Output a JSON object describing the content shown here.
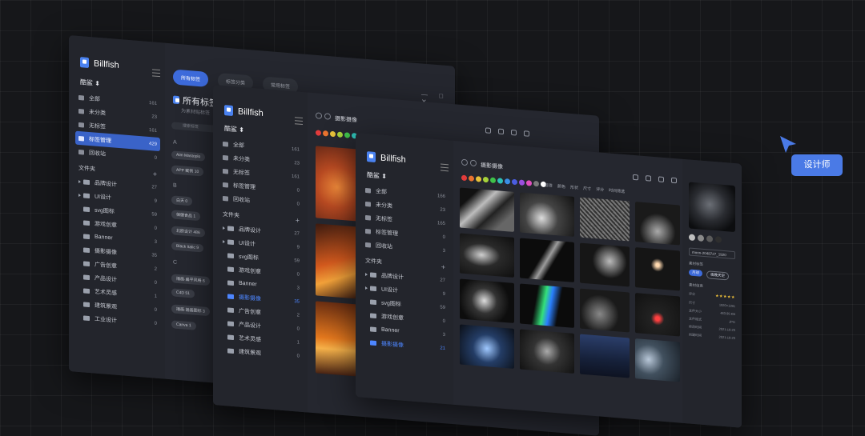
{
  "app": {
    "name": "Billfish",
    "library": "酷鲨"
  },
  "sidebar": {
    "items": [
      {
        "label": "全部",
        "count": "161"
      },
      {
        "label": "未分类",
        "count": "23"
      },
      {
        "label": "无标签",
        "count": "161"
      },
      {
        "label": "标签管理",
        "count": "429"
      },
      {
        "label": "回收站",
        "count": "0"
      }
    ],
    "folders_label": "文件夹",
    "folders": [
      {
        "label": "品牌设计",
        "count": "27"
      },
      {
        "label": "UI设计",
        "count": "9"
      },
      {
        "label": "svg图标",
        "count": "59"
      },
      {
        "label": "游戏创意",
        "count": "0"
      },
      {
        "label": "Banner",
        "count": "3"
      },
      {
        "label": "摄影摄像",
        "count": "35"
      },
      {
        "label": "广告创意",
        "count": "2"
      },
      {
        "label": "产品设计",
        "count": "0"
      },
      {
        "label": "艺术灵感",
        "count": "1"
      },
      {
        "label": "建筑景观",
        "count": "0"
      },
      {
        "label": "工业设计",
        "count": "0"
      }
    ]
  },
  "mid_sidebar": {
    "items": [
      {
        "label": "全部",
        "count": "161"
      },
      {
        "label": "未分类",
        "count": "23"
      },
      {
        "label": "无标签",
        "count": "161"
      },
      {
        "label": "标签管理",
        "count": "0"
      },
      {
        "label": "回收站",
        "count": "0"
      }
    ],
    "folders": [
      {
        "label": "品牌设计",
        "count": "27"
      },
      {
        "label": "UI设计",
        "count": "9"
      },
      {
        "label": "svg图标",
        "count": "59"
      },
      {
        "label": "游戏创意",
        "count": "0"
      },
      {
        "label": "Banner",
        "count": "3"
      },
      {
        "label": "摄影摄像",
        "count": "35"
      },
      {
        "label": "广告创意",
        "count": "2"
      },
      {
        "label": "产品设计",
        "count": "0"
      },
      {
        "label": "艺术灵感",
        "count": "1"
      },
      {
        "label": "建筑景观",
        "count": "0"
      }
    ]
  },
  "front_sidebar": {
    "items": [
      {
        "label": "全部",
        "count": "166"
      },
      {
        "label": "未分类",
        "count": "23"
      },
      {
        "label": "无标签",
        "count": "165"
      },
      {
        "label": "标签管理",
        "count": "0"
      },
      {
        "label": "回收站",
        "count": "3"
      }
    ],
    "folders": [
      {
        "label": "品牌设计",
        "count": "27"
      },
      {
        "label": "UI设计",
        "count": "9"
      },
      {
        "label": "svg图标",
        "count": "59"
      },
      {
        "label": "游戏创意",
        "count": "0"
      },
      {
        "label": "Banner",
        "count": "3"
      },
      {
        "label": "摄影摄像",
        "count": "21"
      }
    ]
  },
  "tags_view": {
    "tabs": [
      "所有标签",
      "标签分类",
      "常用标签"
    ],
    "title": "所有标签",
    "subtitle": "为素材贴标签",
    "search_placeholder": "搜索标签",
    "groups": [
      {
        "letter": "A",
        "tags": [
          "Aim Mastoplo",
          "APP 案例 10"
        ]
      },
      {
        "letter": "B",
        "tags": [
          "白天 0",
          "保健食品 1",
          "北欧设计 486",
          "Black Italic 9"
        ]
      },
      {
        "letter": "C",
        "tags": [
          "插画·扁平风格 6",
          "C4D 51",
          "插画·插画图标 3",
          "Canva 1"
        ]
      }
    ],
    "window_controls": "— □ ✕"
  },
  "photo_view": {
    "folder_title": "摄影摄像",
    "swatch_colors": [
      "#e23b3b",
      "#e8732f",
      "#e6c13a",
      "#a6d23a",
      "#3fc24a",
      "#2fc1b7",
      "#3a8fe6",
      "#4b5de0",
      "#9b4fe0",
      "#e04fbd",
      "#7a7a7a",
      "#ffffff"
    ],
    "filters": [
      "标签",
      "颜色",
      "形状",
      "尺寸",
      "评分",
      "时间筛选"
    ]
  },
  "inspector": {
    "filename": "moon-2048727_1920",
    "tags_label": "素材标签",
    "tag_chips": [
      "月球",
      "夜晚天空"
    ],
    "info_label": "素材信息",
    "rows": [
      {
        "k": "评分",
        "v": "★★★★★"
      },
      {
        "k": "尺寸",
        "v": "1920×1281"
      },
      {
        "k": "文件大小",
        "v": "463.95 KB"
      },
      {
        "k": "文件格式",
        "v": "JPG"
      },
      {
        "k": "修改时间",
        "v": "2021-10-25"
      },
      {
        "k": "创建时间",
        "v": "2021-10-25"
      }
    ]
  },
  "badge": {
    "label": "设计师",
    "color": "#4a7ae6"
  }
}
